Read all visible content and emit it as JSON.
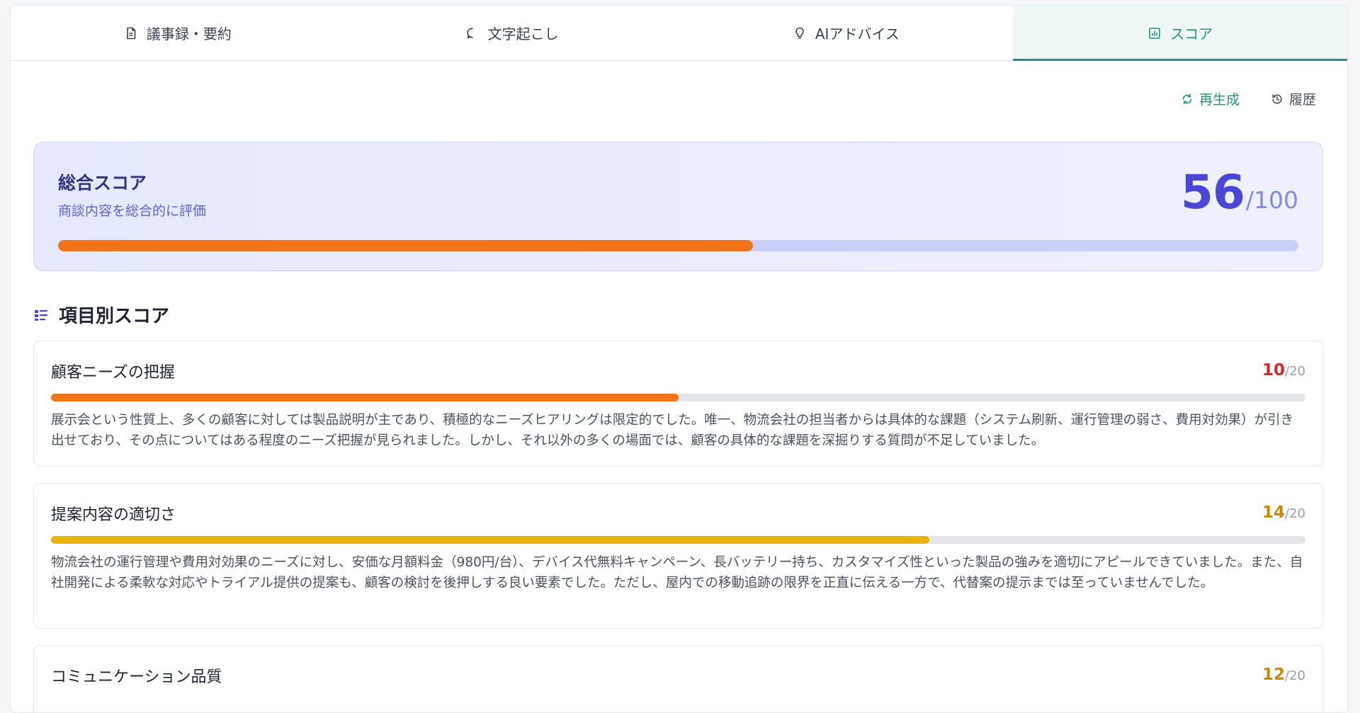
{
  "tabs": [
    {
      "label": "議事録・要約",
      "icon": "document-icon",
      "active": false
    },
    {
      "label": "文字起こし",
      "icon": "chat-bubble-icon",
      "active": false
    },
    {
      "label": "AIアドバイス",
      "icon": "lightbulb-icon",
      "active": false
    },
    {
      "label": "スコア",
      "icon": "chart-icon",
      "active": true
    }
  ],
  "actions": {
    "regenerate": "再生成",
    "history": "履歴"
  },
  "overall": {
    "title": "総合スコア",
    "subtitle": "商談内容を総合的に評価",
    "score": "56",
    "max": "/100",
    "progress": 0.56,
    "fill_color": "#f1741b"
  },
  "section": {
    "title": "項目別スコア",
    "icon": "list-icon"
  },
  "items": [
    {
      "name": "顧客ニーズの把握",
      "score": "10",
      "max": "/20",
      "progress": 0.5,
      "color": "#f1741b",
      "score_color": "#dc2626",
      "description": "展示会という性質上、多くの顧客に対しては製品説明が主であり、積極的なニーズヒアリングは限定的でした。唯一、物流会社の担当者からは具体的な課題（システム刷新、運行管理の弱さ、費用対効果）が引き出せており、その点についてはある程度のニーズ把握が見られました。しかし、それ以外の多くの場面では、顧客の具体的な課題を深掘りする質問が不足していました。"
    },
    {
      "name": "提案内容の適切さ",
      "score": "14",
      "max": "/20",
      "progress": 0.7,
      "color": "#eab308",
      "score_color": "#ca8a04",
      "description": "物流会社の運行管理や費用対効果のニーズに対し、安価な月額料金（980円/台）、デバイス代無料キャンペーン、長バッテリー持ち、カスタマイズ性といった製品の強みを適切にアピールできていました。また、自社開発による柔軟な対応やトライアル提供の提案も、顧客の検討を後押しする良い要素でした。ただし、屋内での移動追跡の限界を正直に伝える一方で、代替案の提示までは至っていませんでした。"
    },
    {
      "name": "コミュニケーション品質",
      "score": "12",
      "max": "/20",
      "progress": 0.6,
      "color": "#eab308",
      "score_color": "#ca8a04",
      "description": ""
    }
  ]
}
